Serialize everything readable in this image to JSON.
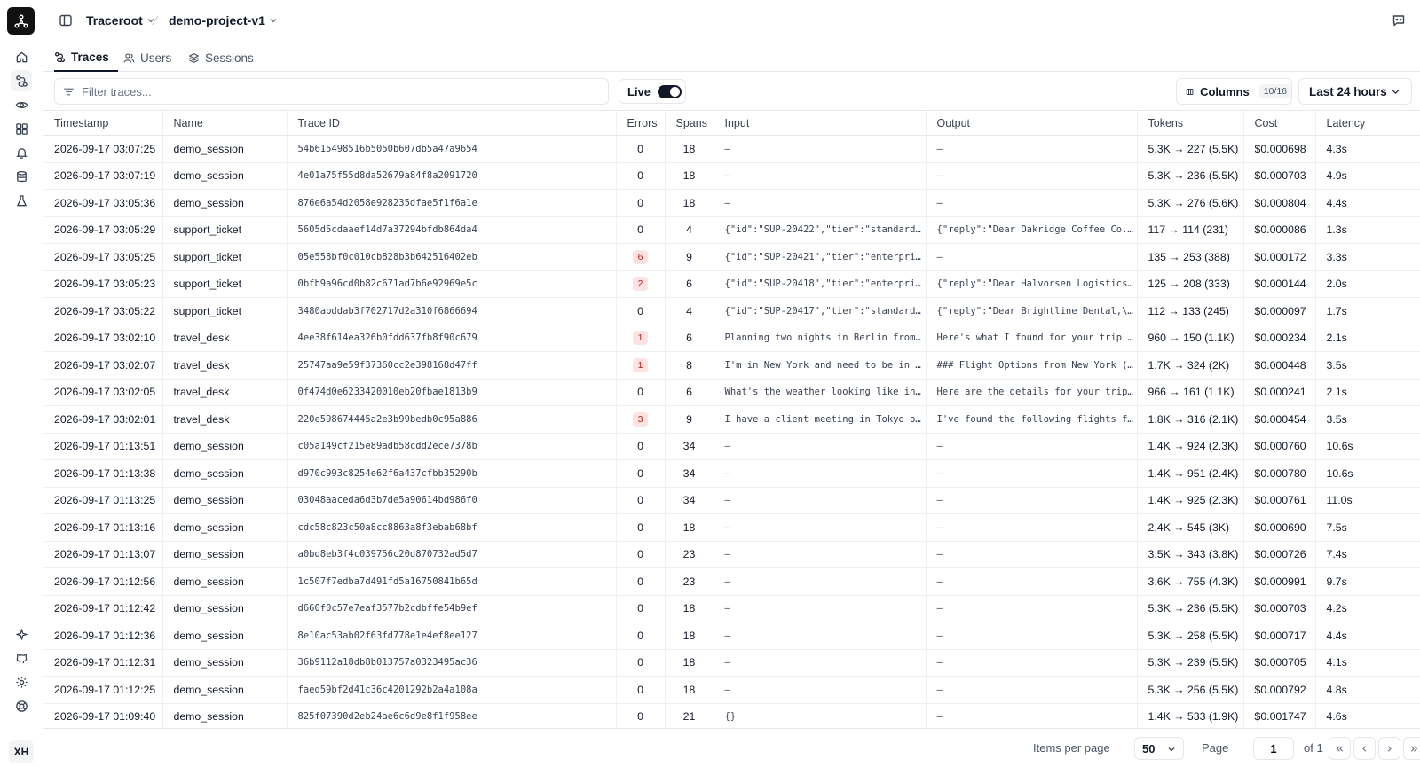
{
  "header": {
    "org": "Traceroot",
    "project": "demo-project-v1"
  },
  "tabs": [
    {
      "label": "Traces",
      "icon": "traces-icon",
      "active": true
    },
    {
      "label": "Users",
      "icon": "users-icon",
      "active": false
    },
    {
      "label": "Sessions",
      "icon": "layers-icon",
      "active": false
    }
  ],
  "toolbar": {
    "filter_placeholder": "Filter traces...",
    "live_label": "Live",
    "live_on": true,
    "columns_label": "Columns",
    "columns_count": "10/16",
    "time_range": "Last 24 hours"
  },
  "table": {
    "columns": [
      "Timestamp",
      "Name",
      "Trace ID",
      "Errors",
      "Spans",
      "Input",
      "Output",
      "Tokens",
      "Cost",
      "Latency"
    ],
    "rows": [
      {
        "timestamp": "2026-09-17 03:07:25",
        "name": "demo_session",
        "trace_id": "54b615498516b5050b607db5a47a9654",
        "errors": 0,
        "spans": 18,
        "input": "–",
        "output": "–",
        "tokens": "5.3K → 227 (5.5K)",
        "cost": "$0.000698",
        "latency": "4.3s"
      },
      {
        "timestamp": "2026-09-17 03:07:19",
        "name": "demo_session",
        "trace_id": "4e01a75f55d8da52679a84f8a2091720",
        "errors": 0,
        "spans": 18,
        "input": "–",
        "output": "–",
        "tokens": "5.3K → 236 (5.5K)",
        "cost": "$0.000703",
        "latency": "4.9s"
      },
      {
        "timestamp": "2026-09-17 03:05:36",
        "name": "demo_session",
        "trace_id": "876e6a54d2058e928235dfae5f1f6a1e",
        "errors": 0,
        "spans": 18,
        "input": "–",
        "output": "–",
        "tokens": "5.3K → 276 (5.6K)",
        "cost": "$0.000804",
        "latency": "4.4s"
      },
      {
        "timestamp": "2026-09-17 03:05:29",
        "name": "support_ticket",
        "trace_id": "5605d5cdaaef14d7a37294bfdb864da4",
        "errors": 0,
        "spans": 4,
        "input": "{\"id\":\"SUP-20422\",\"tier\":\"standard…",
        "output": "{\"reply\":\"Dear Oakridge Coffee Co.…",
        "tokens": "117 → 114 (231)",
        "cost": "$0.000086",
        "latency": "1.3s"
      },
      {
        "timestamp": "2026-09-17 03:05:25",
        "name": "support_ticket",
        "trace_id": "05e558bf0c010cb828b3b642516402eb",
        "errors": 6,
        "spans": 9,
        "input": "{\"id\":\"SUP-20421\",\"tier\":\"enterpri…",
        "output": "–",
        "tokens": "135 → 253 (388)",
        "cost": "$0.000172",
        "latency": "3.3s"
      },
      {
        "timestamp": "2026-09-17 03:05:23",
        "name": "support_ticket",
        "trace_id": "0bfb9a96cd0b82c671ad7b6e92969e5c",
        "errors": 2,
        "spans": 6,
        "input": "{\"id\":\"SUP-20418\",\"tier\":\"enterpri…",
        "output": "{\"reply\":\"Dear Halvorsen Logistics…",
        "tokens": "125 → 208 (333)",
        "cost": "$0.000144",
        "latency": "2.0s"
      },
      {
        "timestamp": "2026-09-17 03:05:22",
        "name": "support_ticket",
        "trace_id": "3480abddab3f702717d2a310f6866694",
        "errors": 0,
        "spans": 4,
        "input": "{\"id\":\"SUP-20417\",\"tier\":\"standard…",
        "output": "{\"reply\":\"Dear Brightline Dental,\\…",
        "tokens": "112 → 133 (245)",
        "cost": "$0.000097",
        "latency": "1.7s"
      },
      {
        "timestamp": "2026-09-17 03:02:10",
        "name": "travel_desk",
        "trace_id": "4ee38f614ea326b0fdd637fb8f90c679",
        "errors": 1,
        "spans": 6,
        "input": "Planning two nights in Berlin from…",
        "output": "Here's what I found for your trip …",
        "tokens": "960 → 150 (1.1K)",
        "cost": "$0.000234",
        "latency": "2.1s"
      },
      {
        "timestamp": "2026-09-17 03:02:07",
        "name": "travel_desk",
        "trace_id": "25747aa9e59f37360cc2e398168d47ff",
        "errors": 1,
        "spans": 8,
        "input": "I'm in New York and need to be in …",
        "output": "### Flight Options from New York (…",
        "tokens": "1.7K → 324 (2K)",
        "cost": "$0.000448",
        "latency": "3.5s"
      },
      {
        "timestamp": "2026-09-17 03:02:05",
        "name": "travel_desk",
        "trace_id": "0f474d0e6233420010eb20fbae1813b9",
        "errors": 0,
        "spans": 6,
        "input": "What's the weather looking like in…",
        "output": "Here are the details for your trip…",
        "tokens": "966 → 161 (1.1K)",
        "cost": "$0.000241",
        "latency": "2.1s"
      },
      {
        "timestamp": "2026-09-17 03:02:01",
        "name": "travel_desk",
        "trace_id": "220e598674445a2e3b99bedb0c95a886",
        "errors": 3,
        "spans": 9,
        "input": "I have a client meeting in Tokyo o…",
        "output": "I've found the following flights f…",
        "tokens": "1.8K → 316 (2.1K)",
        "cost": "$0.000454",
        "latency": "3.5s"
      },
      {
        "timestamp": "2026-09-17 01:13:51",
        "name": "demo_session",
        "trace_id": "c05a149cf215e89adb58cdd2ece7378b",
        "errors": 0,
        "spans": 34,
        "input": "–",
        "output": "–",
        "tokens": "1.4K → 924 (2.3K)",
        "cost": "$0.000760",
        "latency": "10.6s"
      },
      {
        "timestamp": "2026-09-17 01:13:38",
        "name": "demo_session",
        "trace_id": "d970c993c8254e62f6a437cfbb35290b",
        "errors": 0,
        "spans": 34,
        "input": "–",
        "output": "–",
        "tokens": "1.4K → 951 (2.4K)",
        "cost": "$0.000780",
        "latency": "10.6s"
      },
      {
        "timestamp": "2026-09-17 01:13:25",
        "name": "demo_session",
        "trace_id": "03048aaceda6d3b7de5a90614bd986f0",
        "errors": 0,
        "spans": 34,
        "input": "–",
        "output": "–",
        "tokens": "1.4K → 925 (2.3K)",
        "cost": "$0.000761",
        "latency": "11.0s"
      },
      {
        "timestamp": "2026-09-17 01:13:16",
        "name": "demo_session",
        "trace_id": "cdc58c823c50a8cc8863a8f3ebab68bf",
        "errors": 0,
        "spans": 18,
        "input": "–",
        "output": "–",
        "tokens": "2.4K → 545 (3K)",
        "cost": "$0.000690",
        "latency": "7.5s"
      },
      {
        "timestamp": "2026-09-17 01:13:07",
        "name": "demo_session",
        "trace_id": "a0bd8eb3f4c039756c20d870732ad5d7",
        "errors": 0,
        "spans": 23,
        "input": "–",
        "output": "–",
        "tokens": "3.5K → 343 (3.8K)",
        "cost": "$0.000726",
        "latency": "7.4s"
      },
      {
        "timestamp": "2026-09-17 01:12:56",
        "name": "demo_session",
        "trace_id": "1c507f7edba7d491fd5a16750841b65d",
        "errors": 0,
        "spans": 23,
        "input": "–",
        "output": "–",
        "tokens": "3.6K → 755 (4.3K)",
        "cost": "$0.000991",
        "latency": "9.7s"
      },
      {
        "timestamp": "2026-09-17 01:12:42",
        "name": "demo_session",
        "trace_id": "d660f0c57e7eaf3577b2cdbffe54b9ef",
        "errors": 0,
        "spans": 18,
        "input": "–",
        "output": "–",
        "tokens": "5.3K → 236 (5.5K)",
        "cost": "$0.000703",
        "latency": "4.2s"
      },
      {
        "timestamp": "2026-09-17 01:12:36",
        "name": "demo_session",
        "trace_id": "8e10ac53ab02f63fd778e1e4ef8ee127",
        "errors": 0,
        "spans": 18,
        "input": "–",
        "output": "–",
        "tokens": "5.3K → 258 (5.5K)",
        "cost": "$0.000717",
        "latency": "4.4s"
      },
      {
        "timestamp": "2026-09-17 01:12:31",
        "name": "demo_session",
        "trace_id": "36b9112a18db8b013757a0323495ac36",
        "errors": 0,
        "spans": 18,
        "input": "–",
        "output": "–",
        "tokens": "5.3K → 239 (5.5K)",
        "cost": "$0.000705",
        "latency": "4.1s"
      },
      {
        "timestamp": "2026-09-17 01:12:25",
        "name": "demo_session",
        "trace_id": "faed59bf2d41c36c4201292b2a4a108a",
        "errors": 0,
        "spans": 18,
        "input": "–",
        "output": "–",
        "tokens": "5.3K → 256 (5.5K)",
        "cost": "$0.000792",
        "latency": "4.8s"
      },
      {
        "timestamp": "2026-09-17 01:09:40",
        "name": "demo_session",
        "trace_id": "825f07390d2eb24ae6c6d9e8f1f958ee",
        "errors": 0,
        "spans": 21,
        "input": "{}",
        "output": "–",
        "tokens": "1.4K → 533 (1.9K)",
        "cost": "$0.001747",
        "latency": "4.6s"
      }
    ]
  },
  "footer": {
    "items_per_page_label": "Items per page",
    "items_per_page": "50",
    "page_label": "Page",
    "page_value": "1",
    "of_label": "of 1"
  },
  "user": {
    "initials": "XH"
  },
  "colors": {
    "error_badge_bg": "#fde2e2",
    "error_badge_text": "#b91c1c",
    "accent": "#111827"
  }
}
